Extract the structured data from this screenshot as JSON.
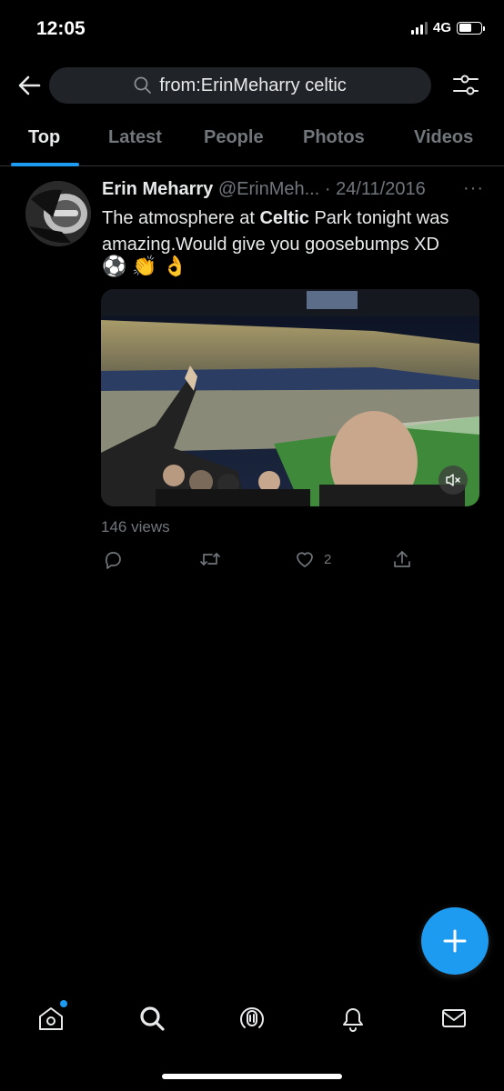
{
  "status_bar": {
    "time": "12:05",
    "network": "4G",
    "battery_level": 0.6
  },
  "header": {
    "back_icon": "arrow-left-icon",
    "search_query": "from:ErinMeharry celtic",
    "search_icon": "search-icon",
    "filter_icon": "sliders-icon"
  },
  "tabs": [
    {
      "label": "Top",
      "active": true
    },
    {
      "label": "Latest",
      "active": false
    },
    {
      "label": "People",
      "active": false
    },
    {
      "label": "Photos",
      "active": false
    },
    {
      "label": "Videos",
      "active": false
    }
  ],
  "tweet": {
    "author_name": "Erin Meharry",
    "handle": "@ErinMeh...",
    "separator": "·",
    "date": "24/11/2016",
    "more_label": "···",
    "text_before": "The atmosphere at ",
    "text_bold": "Celtic",
    "text_after": " Park tonight was amazing.Would give you goosebumps XD",
    "emojis": [
      "⚽",
      "👏",
      "👌"
    ],
    "media_icon": "mute-icon",
    "views": "146 views",
    "like_count": "2"
  },
  "fab_icon": "plus-icon",
  "bottom_nav": [
    {
      "name": "home-icon",
      "has_dot": true
    },
    {
      "name": "search-icon",
      "has_dot": false
    },
    {
      "name": "spaces-icon",
      "has_dot": false
    },
    {
      "name": "bell-icon",
      "has_dot": false
    },
    {
      "name": "mail-icon",
      "has_dot": false
    }
  ],
  "colors": {
    "accent": "#1d9bf0",
    "background": "#000000",
    "muted": "#71767b",
    "search_bg": "#202327"
  }
}
